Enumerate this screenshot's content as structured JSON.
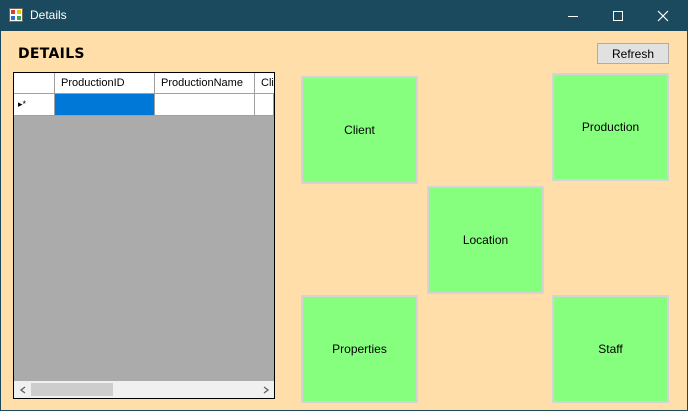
{
  "window": {
    "title": "Details"
  },
  "header": {
    "title": "DETAILS",
    "refresh_label": "Refresh"
  },
  "grid": {
    "columns": [
      "ProductionID",
      "ProductionName",
      "Cli"
    ],
    "new_row_marker": "▸*"
  },
  "tiles": {
    "client": "Client",
    "production": "Production",
    "location": "Location",
    "properties": "Properties",
    "staff": "Staff"
  },
  "colors": {
    "titlebar": "#1b4a5e",
    "background": "#ffdeaa",
    "tile": "#86ff7e",
    "selection": "#0078d7"
  }
}
